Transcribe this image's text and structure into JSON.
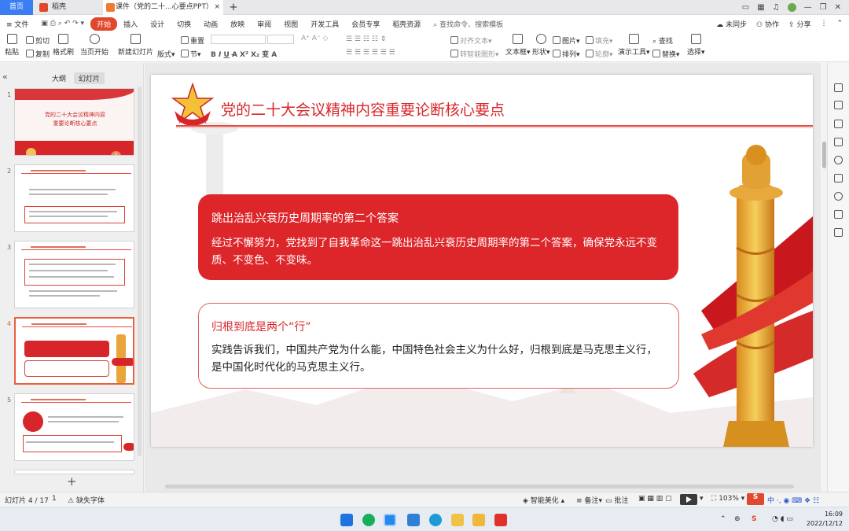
{
  "tabs": {
    "home": "首页",
    "docer": "稻壳",
    "document": "课件（党的二十...心要点PPT）",
    "close": "×",
    "add": "+"
  },
  "menu": {
    "file": "≡ 文件",
    "items": [
      "开始",
      "插入",
      "设计",
      "切换",
      "动画",
      "放映",
      "审阅",
      "视图",
      "开发工具",
      "会员专享",
      "稻壳资源"
    ],
    "search_placeholder": "查找命令、搜索模板",
    "sync": "未同步",
    "collab": "协作",
    "share": "分享"
  },
  "ribbon": {
    "paste": "粘贴",
    "cut": "剪切",
    "copy": "复制",
    "format_painter": "格式刷",
    "play_from_current": "当页开始",
    "new_slide": "新建幻灯片",
    "layout": "版式",
    "section": "节",
    "reset": "重置",
    "align_text": "对齐文本",
    "to_smartart": "转智能图形",
    "textbox": "文本框",
    "shape": "形状",
    "picture": "图片",
    "arrange": "排列",
    "fill": "填充",
    "outline": "轮廓",
    "presentation_tools": "演示工具",
    "find": "查找",
    "replace": "替换",
    "select": "选择"
  },
  "left_panel": {
    "tab_outline": "大纲",
    "tab_slides": "幻灯片",
    "slide_numbers": [
      "1",
      "2",
      "3",
      "4",
      "5"
    ],
    "thumb1_title": "党的二十大会议精神内容",
    "thumb1_subtitle": "重要论断核心要点"
  },
  "slide": {
    "title": "党的二十大会议精神内容重要论断核心要点",
    "card1": {
      "title": "跳出治乱兴衰历史周期率的第二个答案",
      "body": "经过不懈努力，党找到了自我革命这一跳出治乱兴衰历史周期率的第二个答案，确保党永远不变质、不变色、不变味。"
    },
    "card2": {
      "title": "归根到底是两个“行”",
      "body": "实践告诉我们，中国共产党为什么能，中国特色社会主义为什么好，归根到底是马克思主义行，是中国化时代化的马克思主义行。"
    }
  },
  "status": {
    "slide_counter": "幻灯片 4 / 17",
    "missing_font": "缺失字体",
    "smart_beautify": "智能美化",
    "notes": "备注",
    "comments": "批注",
    "zoom": "103%"
  },
  "taskbar": {
    "time": "16:09",
    "date": "2022/12/12"
  },
  "colors": {
    "accent_red": "#d7262a",
    "tab_blue": "#3b7ef3",
    "menu_active": "#e0472c"
  }
}
